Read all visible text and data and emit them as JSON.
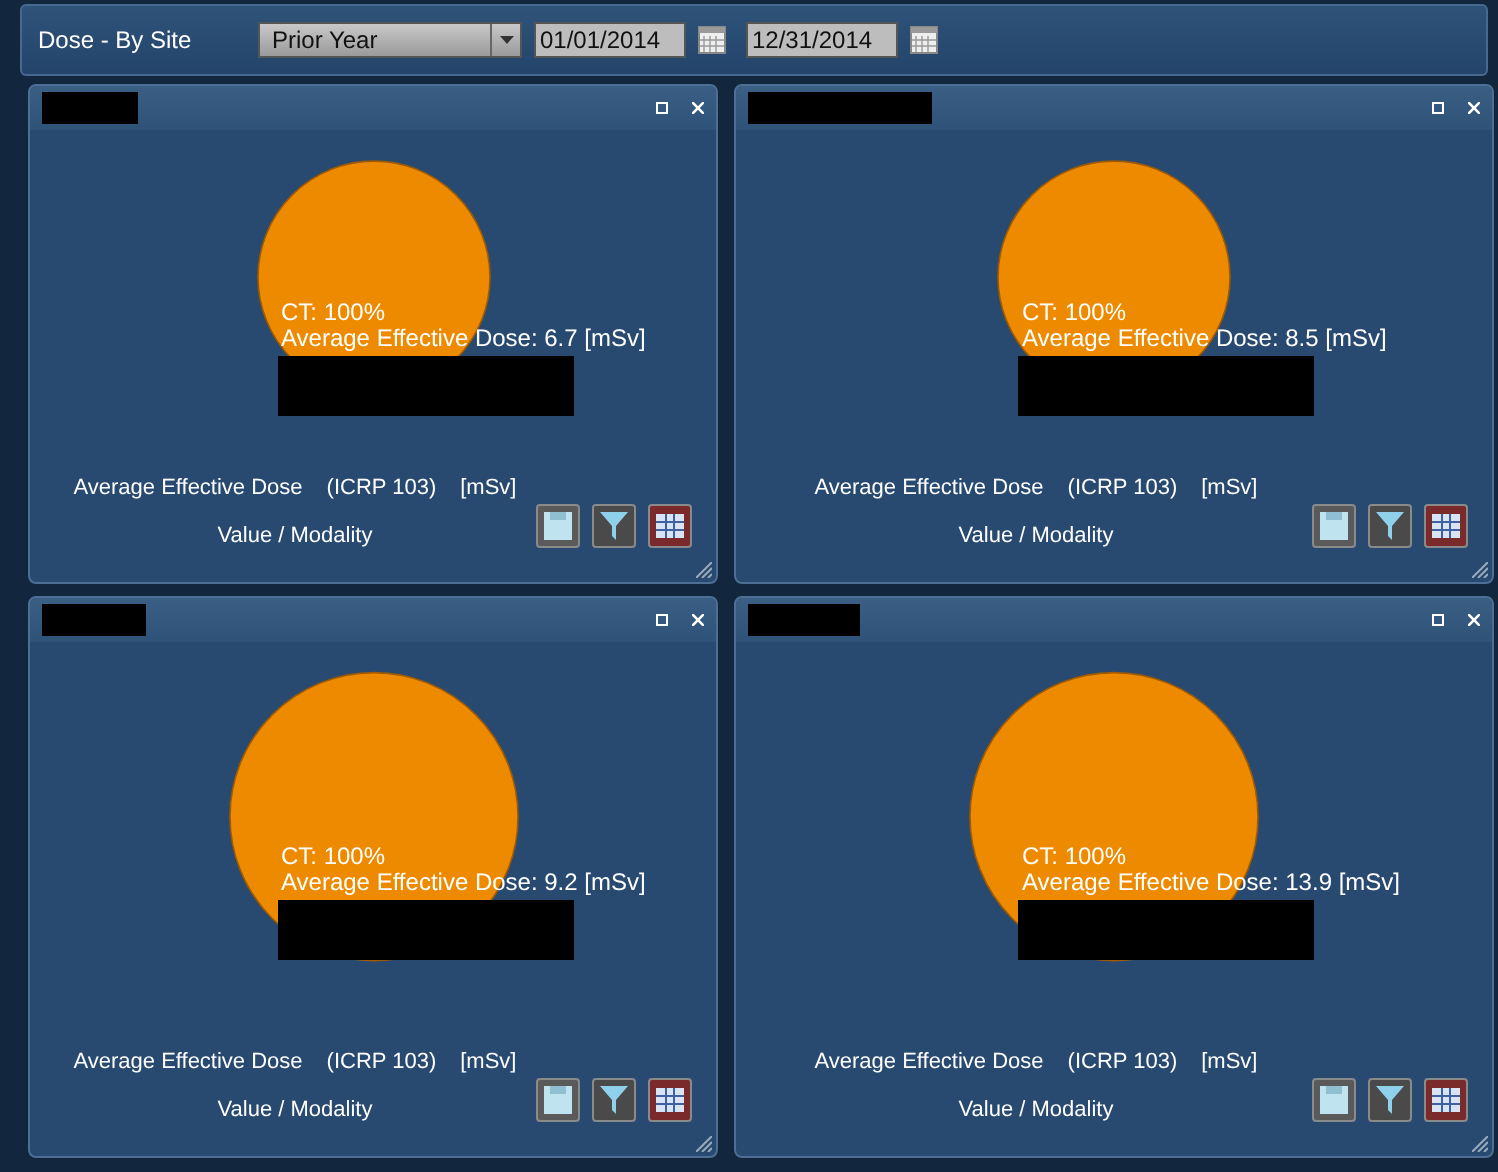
{
  "toolbar": {
    "title": "Dose - By Site",
    "period": "Prior Year",
    "start_date": "01/01/2014",
    "end_date": "12/31/2014"
  },
  "panels": [
    {
      "tooltip": [
        "CT: 100%",
        "Average Effective Dose: 6.7 [mSv]"
      ],
      "legend": [
        "Average Effective Dose",
        "(ICRP 103)",
        "[mSv]"
      ],
      "x_label": "Value / Modality"
    },
    {
      "tooltip": [
        "CT: 100%",
        "Average Effective Dose: 8.5 [mSv]"
      ],
      "legend": [
        "Average Effective Dose",
        "(ICRP 103)",
        "[mSv]"
      ],
      "x_label": "Value / Modality"
    },
    {
      "tooltip": [
        "CT: 100%",
        "Average Effective Dose: 9.2 [mSv]"
      ],
      "legend": [
        "Average Effective Dose",
        "(ICRP 103)",
        "[mSv]"
      ],
      "x_label": "Value / Modality"
    },
    {
      "tooltip": [
        "CT: 100%",
        "Average Effective Dose: 13.9 [mSv]"
      ],
      "legend": [
        "Average Effective Dose",
        "(ICRP 103)",
        "[mSv]"
      ],
      "x_label": "Value / Modality"
    }
  ]
}
